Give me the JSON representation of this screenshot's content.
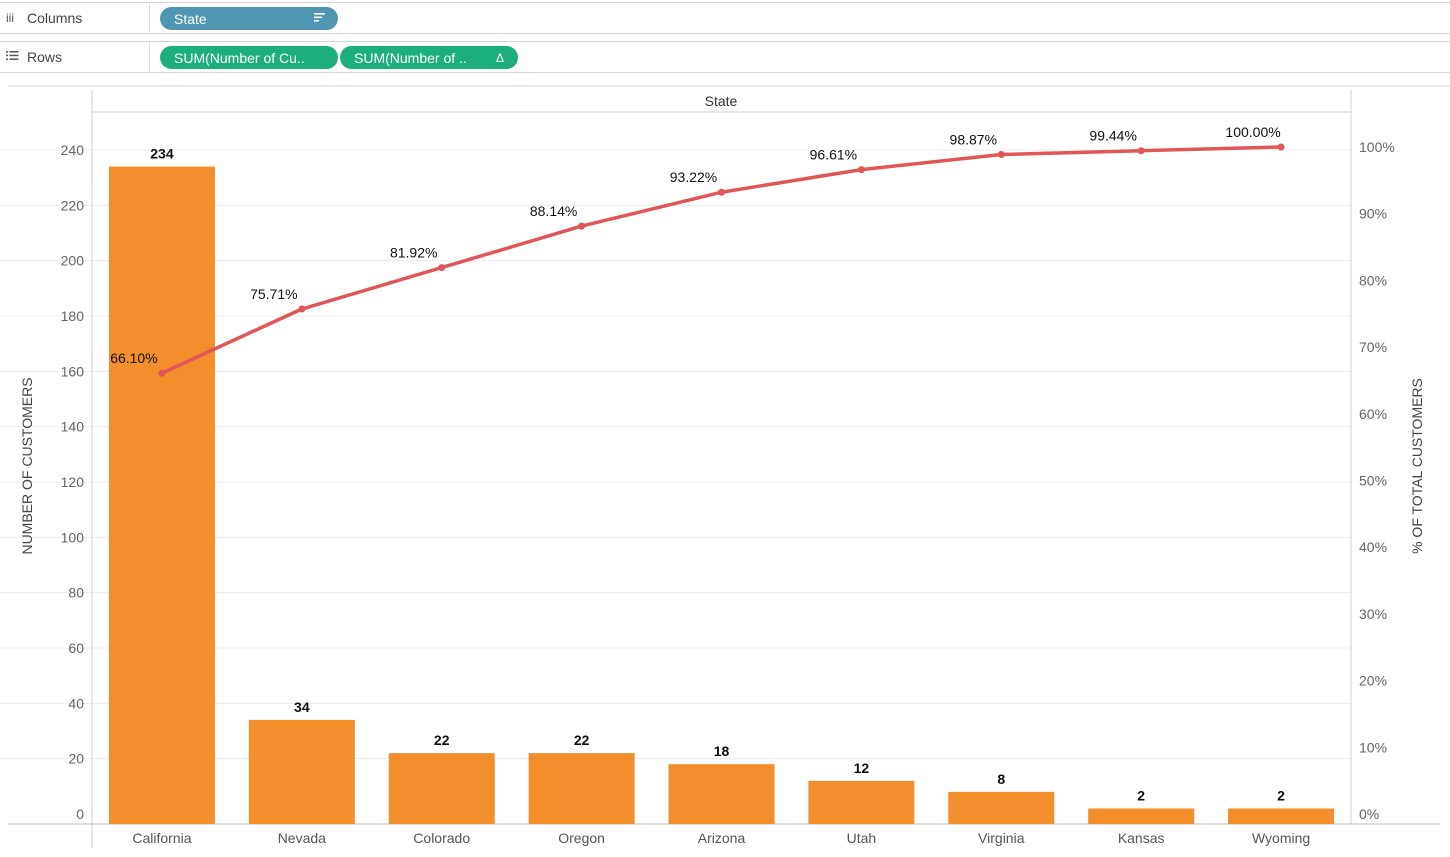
{
  "shelves": {
    "columns": {
      "label": "Columns",
      "icon": "columns-icon",
      "pills": [
        {
          "text": "State",
          "icon": "sort-icon",
          "kind": "dimension"
        }
      ]
    },
    "rows": {
      "label": "Rows",
      "icon": "rows-icon",
      "pills": [
        {
          "text": "SUM(Number of Cu..",
          "kind": "measure"
        },
        {
          "text": "SUM(Number of ..",
          "icon": "delta-icon",
          "kind": "measure"
        }
      ]
    }
  },
  "colors": {
    "bar": "#f28e2b",
    "line": "#e05759",
    "pill_dimension": "#4e96b2",
    "pill_measure": "#1cae7c"
  },
  "chart_data": {
    "type": "bar",
    "header": "State",
    "categories": [
      "California",
      "Nevada",
      "Colorado",
      "Oregon",
      "Arizona",
      "Utah",
      "Virginia",
      "Kansas",
      "Wyoming"
    ],
    "series": [
      {
        "values": [
          234,
          34,
          22,
          22,
          18,
          12,
          8,
          2,
          2
        ],
        "type": "bar",
        "axis": "left"
      },
      {
        "values": [
          66.1,
          75.71,
          81.92,
          88.14,
          93.22,
          96.61,
          98.87,
          99.44,
          100.0
        ],
        "type": "line",
        "axis": "right"
      }
    ],
    "bar_labels": [
      "234",
      "34",
      "22",
      "22",
      "18",
      "12",
      "8",
      "2",
      "2"
    ],
    "line_labels": [
      "66.10%",
      "75.71%",
      "81.92%",
      "88.14%",
      "93.22%",
      "96.61%",
      "98.87%",
      "99.44%",
      "100.00%"
    ],
    "ylabel": "NUMBER OF CUSTOMERS",
    "ylim": [
      0,
      240
    ],
    "yticks": [
      "240",
      "220",
      "200",
      "180",
      "160",
      "140",
      "120",
      "100",
      "80",
      "60",
      "40",
      "20",
      "0"
    ],
    "y2label": "% OF TOTAL CUSTOMERS",
    "y2lim": [
      0,
      100
    ],
    "y2ticks": [
      "100%",
      "90%",
      "80%",
      "70%",
      "60%",
      "50%",
      "40%",
      "30%",
      "20%",
      "10%",
      "0%"
    ],
    "grid": true
  }
}
